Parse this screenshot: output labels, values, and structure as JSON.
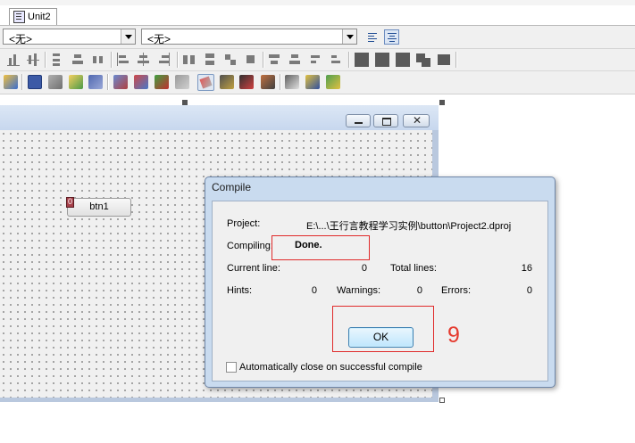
{
  "editor": {
    "tabs": [
      {
        "label": "Unit2",
        "icon": "unit-file-icon"
      }
    ],
    "combo_left": {
      "value": "<无>"
    },
    "combo_right": {
      "value": "<无>"
    }
  },
  "designer": {
    "button": {
      "label": "btn1",
      "badge": "0"
    }
  },
  "compile_dialog": {
    "title": "Compile",
    "project_label": "Project:",
    "project_path": "E:\\...\\王行言教程学习实例\\button\\Project2.dproj",
    "compiling_label": "Compiling:",
    "compiling_status": "Done.",
    "current_line_label": "Current line:",
    "current_line_value": "0",
    "total_lines_label": "Total lines:",
    "total_lines_value": "16",
    "hints_label": "Hints:",
    "hints_value": "0",
    "warnings_label": "Warnings:",
    "warnings_value": "0",
    "errors_label": "Errors:",
    "errors_value": "0",
    "ok_label": "OK",
    "auto_close_label": "Automatically close on successful compile",
    "auto_close_checked": false
  },
  "annotation": {
    "step_number": "9",
    "color": "#e53a2e"
  }
}
